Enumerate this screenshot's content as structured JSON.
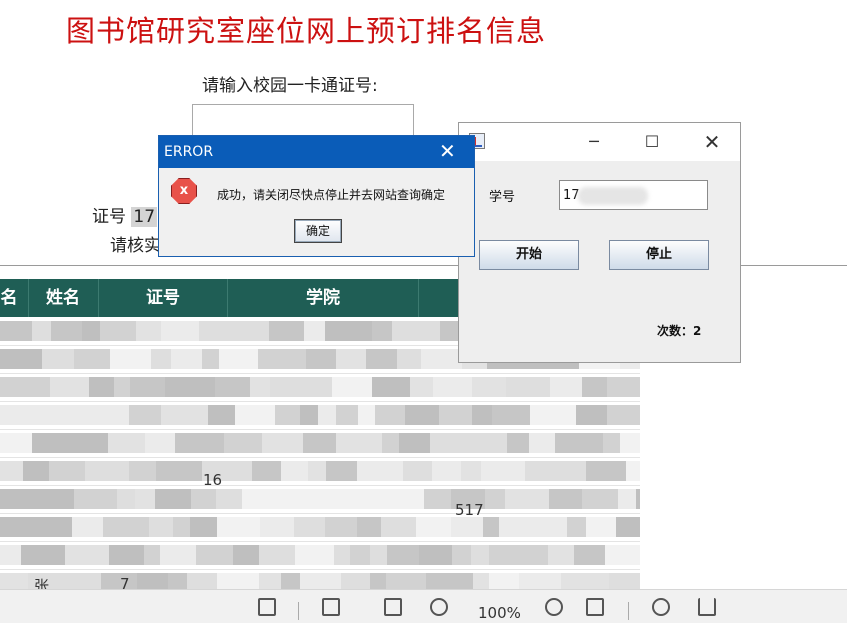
{
  "page": {
    "title": "图书馆研究室座位网上预订排名信息",
    "id_prompt": "请输入校园一卡通证号:",
    "cert_prefix": "证号",
    "cert_visible": "17",
    "verify_prefix": "请核实"
  },
  "table": {
    "headers": [
      "名",
      "姓名",
      "证号",
      "学院"
    ],
    "header_color": "#1f5e55",
    "visible_fragments": [
      "张",
      "7",
      "16",
      "517"
    ]
  },
  "toolbar": {
    "zoom": "100%"
  },
  "java_window": {
    "student_label": "学号",
    "student_value": "17",
    "start_label": "开始",
    "stop_label": "停止",
    "count_label": "次数：2",
    "minimize": "─",
    "maximize": "☐",
    "close": "✕"
  },
  "error_dialog": {
    "title": "ERROR",
    "message": "成功，请关闭尽快点停止并去网站查询确定",
    "ok_label": "确定",
    "icon_glyph": "x",
    "close": "✕",
    "title_color": "#0a5cb8"
  }
}
